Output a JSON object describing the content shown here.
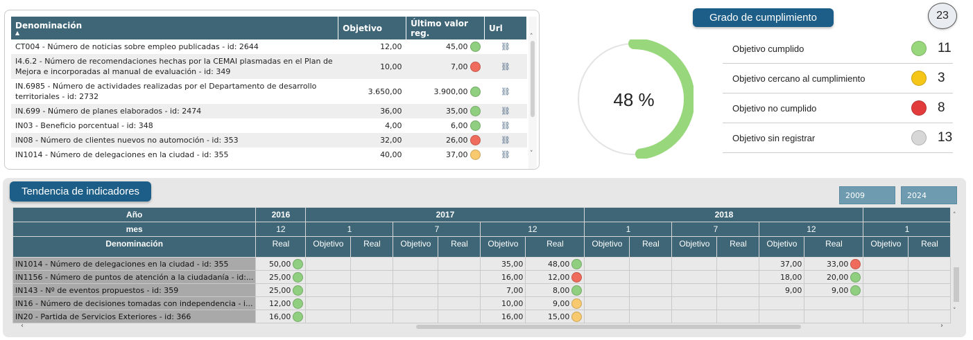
{
  "indicator_table": {
    "headers": {
      "name": "Denominación",
      "target": "Objetivo",
      "last_value": "Último valor reg.",
      "url": "Url"
    },
    "rows": [
      {
        "name": "CT004 - Número de noticias sobre empleo publicadas - id: 2644",
        "target": "12,00",
        "value": "45,00",
        "status": "green",
        "link_icon": "link-icon"
      },
      {
        "name": "I4.6.2 - Número de recomendaciones hechas por la CEMAI plasmadas en el Plan de Mejora e incorporadas al manual de evaluación - id: 349",
        "target": "10,00",
        "value": "7,00",
        "status": "red",
        "link_icon": "link-icon"
      },
      {
        "name": "IN.6985 - Número de actividades realizadas por el Departamento de desarrollo territoriales - id: 2732",
        "target": "3.650,00",
        "value": "3.900,00",
        "status": "green",
        "link_icon": "link-icon"
      },
      {
        "name": "IN.699 - Número de planes elaborados - id: 2474",
        "target": "36,00",
        "value": "35,00",
        "status": "green",
        "link_icon": "link-icon"
      },
      {
        "name": "IN03 - Beneficio porcentual - id: 348",
        "target": "4,00",
        "value": "6,00",
        "status": "green",
        "link_icon": "link-icon"
      },
      {
        "name": "IN08 - Número de clientes nuevos no automoción - id: 353",
        "target": "32,00",
        "value": "26,00",
        "status": "red",
        "link_icon": "link-icon"
      },
      {
        "name": "IN1014 - Número de delegaciones en la ciudad - id: 355",
        "target": "40,00",
        "value": "37,00",
        "status": "yellow",
        "link_icon": "link-icon"
      }
    ]
  },
  "gauge": {
    "label": "48 %",
    "percent": 48,
    "color": "#98d77b"
  },
  "grado": {
    "title": "Grado de cumplimiento",
    "total": "23",
    "items": [
      {
        "label": "Objetivo cumplido",
        "count": "11",
        "color": "#98d77b"
      },
      {
        "label": "Objetivo cercano al cumplimiento",
        "count": "3",
        "color": "#f5c518"
      },
      {
        "label": "Objetivo no cumplido",
        "count": "8",
        "color": "#e23b3b"
      },
      {
        "label": "Objetivo sin registrar",
        "count": "13",
        "color": "#d7d7d7"
      }
    ]
  },
  "tendencia": {
    "title": "Tendencia de indicadores",
    "year_from": "2009",
    "year_to": "2024",
    "row_labels": {
      "year": "Año",
      "month": "mes",
      "name": "Denominación"
    },
    "years": [
      "2016",
      "2017",
      "2018"
    ],
    "months": [
      "12",
      "1",
      "7",
      "12",
      "1",
      "7",
      "12",
      "1"
    ],
    "measures": {
      "objective": "Objetivo",
      "real": "Real"
    },
    "rows": [
      {
        "name": "IN1014 - Número de delegaciones en la ciudad - id: 355",
        "r2016_12": "50,00",
        "s2016_12": "green",
        "o2017_12": "35,00",
        "r2017_12": "48,00",
        "s2017_12": "green",
        "o2018_12": "37,00",
        "r2018_12": "33,00",
        "s2018_12": "red"
      },
      {
        "name": "IN1156 - Número de puntos de atención a la ciudadanía - id:...",
        "r2016_12": "25,00",
        "s2016_12": "green",
        "o2017_12": "16,00",
        "r2017_12": "12,00",
        "s2017_12": "red",
        "o2018_12": "18,00",
        "r2018_12": "20,00",
        "s2018_12": "green"
      },
      {
        "name": "IN143 - Nº de eventos propuestos - id: 359",
        "r2016_12": "25,00",
        "s2016_12": "green",
        "o2017_12": "7,00",
        "r2017_12": "8,00",
        "s2017_12": "green",
        "o2018_12": "9,00",
        "r2018_12": "9,00",
        "s2018_12": "green"
      },
      {
        "name": "IN16 - Número de decisiones tomadas con independencia - i...",
        "r2016_12": "12,00",
        "s2016_12": "green",
        "o2017_12": "10,00",
        "r2017_12": "9,00",
        "s2017_12": "yellow",
        "o2018_12": "",
        "r2018_12": "",
        "s2018_12": ""
      },
      {
        "name": "IN20 - Partida de Servicios Exteriores - id: 366",
        "r2016_12": "16,00",
        "s2016_12": "green",
        "o2017_12": "16,00",
        "r2017_12": "15,00",
        "s2017_12": "yellow",
        "o2018_12": "",
        "r2018_12": "",
        "s2018_12": ""
      }
    ]
  },
  "status_colors": {
    "green": "#8fcf7f",
    "red": "#ef6b5b",
    "yellow": "#f8c96e"
  }
}
